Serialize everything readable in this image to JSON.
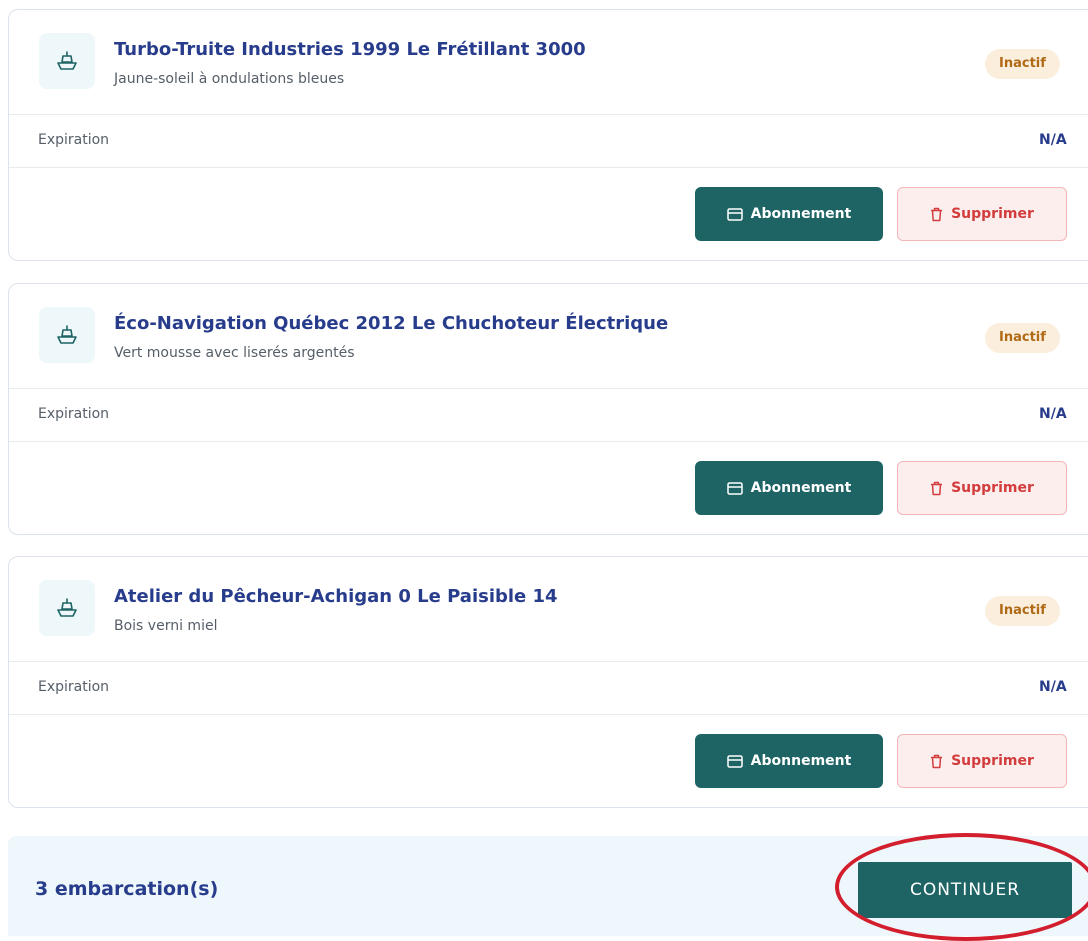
{
  "boats": [
    {
      "title": "Turbo-Truite Industries 1999 Le Frétillant 3000",
      "subtitle": "Jaune-soleil à ondulations bleues",
      "status": "Inactif",
      "expiration_label": "Expiration",
      "expiration_value": "N/A",
      "subscription_label": "Abonnement",
      "delete_label": "Supprimer"
    },
    {
      "title": "Éco-Navigation Québec 2012 Le Chuchoteur Électrique",
      "subtitle": "Vert mousse avec liserés argentés",
      "status": "Inactif",
      "expiration_label": "Expiration",
      "expiration_value": "N/A",
      "subscription_label": "Abonnement",
      "delete_label": "Supprimer"
    },
    {
      "title": "Atelier du Pêcheur-Achigan 0 Le Paisible 14",
      "subtitle": "Bois verni miel",
      "status": "Inactif",
      "expiration_label": "Expiration",
      "expiration_value": "N/A",
      "subscription_label": "Abonnement",
      "delete_label": "Supprimer"
    }
  ],
  "footer": {
    "count_text": "3 embarcation(s)",
    "continue_label": "CONTINUER"
  },
  "icons": {
    "boat": "boat-icon",
    "subscription": "card-icon",
    "delete": "trash-icon"
  },
  "colors": {
    "primary": "#1e6464",
    "title": "#283c8c",
    "inactive_bg": "#fbeedd",
    "inactive_text": "#b06a16",
    "danger": "#d23c3c",
    "highlight": "#d21e2d"
  }
}
